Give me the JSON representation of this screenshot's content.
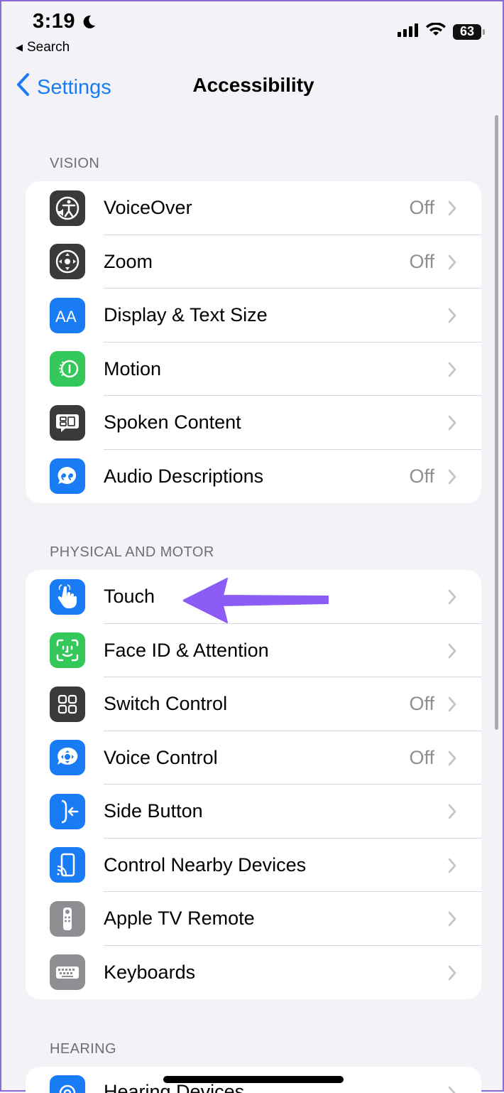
{
  "status": {
    "time": "3:19",
    "battery": "63",
    "back_app": "Search"
  },
  "nav": {
    "back_label": "Settings",
    "title": "Accessibility"
  },
  "colors": {
    "accent": "#1a7cf5",
    "blue_icon": "#1a7cf5",
    "green_icon": "#34c759",
    "dark_icon": "#3a3a3c",
    "gray_icon": "#8e8e93",
    "annotation_arrow": "#8b5cf6"
  },
  "sections": [
    {
      "header": "VISION",
      "rows": [
        {
          "label": "VoiceOver",
          "value": "Off",
          "icon": "voiceover-icon"
        },
        {
          "label": "Zoom",
          "value": "Off",
          "icon": "zoom-icon"
        },
        {
          "label": "Display & Text Size",
          "value": "",
          "icon": "text-size-icon"
        },
        {
          "label": "Motion",
          "value": "",
          "icon": "motion-icon"
        },
        {
          "label": "Spoken Content",
          "value": "",
          "icon": "spoken-content-icon"
        },
        {
          "label": "Audio Descriptions",
          "value": "Off",
          "icon": "audio-descriptions-icon"
        }
      ]
    },
    {
      "header": "PHYSICAL AND MOTOR",
      "rows": [
        {
          "label": "Touch",
          "value": "",
          "icon": "touch-icon"
        },
        {
          "label": "Face ID & Attention",
          "value": "",
          "icon": "face-id-icon"
        },
        {
          "label": "Switch Control",
          "value": "Off",
          "icon": "switch-control-icon"
        },
        {
          "label": "Voice Control",
          "value": "Off",
          "icon": "voice-control-icon"
        },
        {
          "label": "Side Button",
          "value": "",
          "icon": "side-button-icon"
        },
        {
          "label": "Control Nearby Devices",
          "value": "",
          "icon": "nearby-devices-icon"
        },
        {
          "label": "Apple TV Remote",
          "value": "",
          "icon": "tv-remote-icon"
        },
        {
          "label": "Keyboards",
          "value": "",
          "icon": "keyboard-icon"
        }
      ]
    },
    {
      "header": "HEARING",
      "rows": [
        {
          "label": "Hearing Devices",
          "value": "",
          "icon": "hearing-devices-icon"
        }
      ]
    }
  ]
}
